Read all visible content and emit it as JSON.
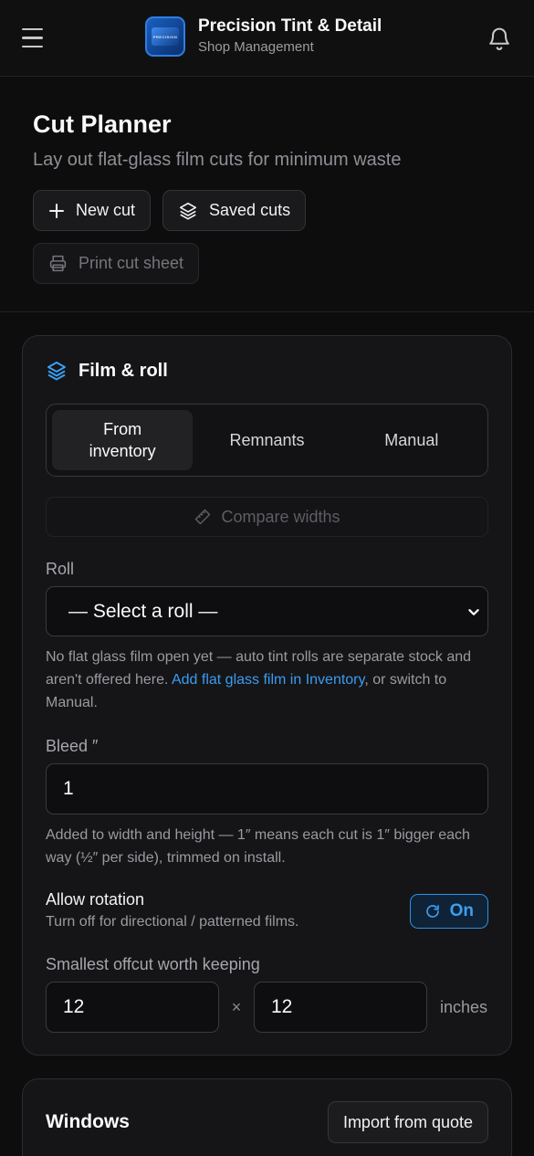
{
  "app": {
    "title": "Precision Tint & Detail",
    "subtitle": "Shop Management",
    "logo_text": "PRECISION",
    "menu_icon": "hamburger-menu-icon",
    "notification_icon": "bell-icon"
  },
  "page": {
    "title": "Cut Planner",
    "subtitle": "Lay out flat-glass film cuts for minimum waste",
    "actions": {
      "new_cut": "New cut",
      "saved_cuts": "Saved cuts",
      "print_cut_sheet": "Print cut sheet"
    }
  },
  "film_roll": {
    "title": "Film & roll",
    "tabs": [
      "From inventory",
      "Remnants",
      "Manual"
    ],
    "active_tab": "From inventory",
    "compare_widths": "Compare widths",
    "roll_label": "Roll",
    "roll_value": "— Select a roll —",
    "roll_help_text": "No flat glass film open yet — auto tint rolls are separate stock and aren't offered here.",
    "roll_help_link": "Add flat glass film in Inventory",
    "roll_help_tail": ", or switch to Manual.",
    "bleed_label": "Bleed ″",
    "bleed_value": "1",
    "bleed_help": "Added to width and height — 1″ means each cut is 1″ bigger each way (½″ per side), trimmed on install.",
    "rotation_title": "Allow rotation",
    "rotation_sub": "Turn off for directional / patterned films.",
    "rotation_toggle": "On",
    "offcut_label": "Smallest offcut worth keeping",
    "offcut_width": "12",
    "offcut_height": "12",
    "offcut_times": "×",
    "offcut_unit": "inches"
  },
  "windows": {
    "title": "Windows",
    "import_button": "Import from quote"
  },
  "colors": {
    "accent": "#3aa0f5",
    "background": "#0d0d0e",
    "card": "#151517"
  }
}
